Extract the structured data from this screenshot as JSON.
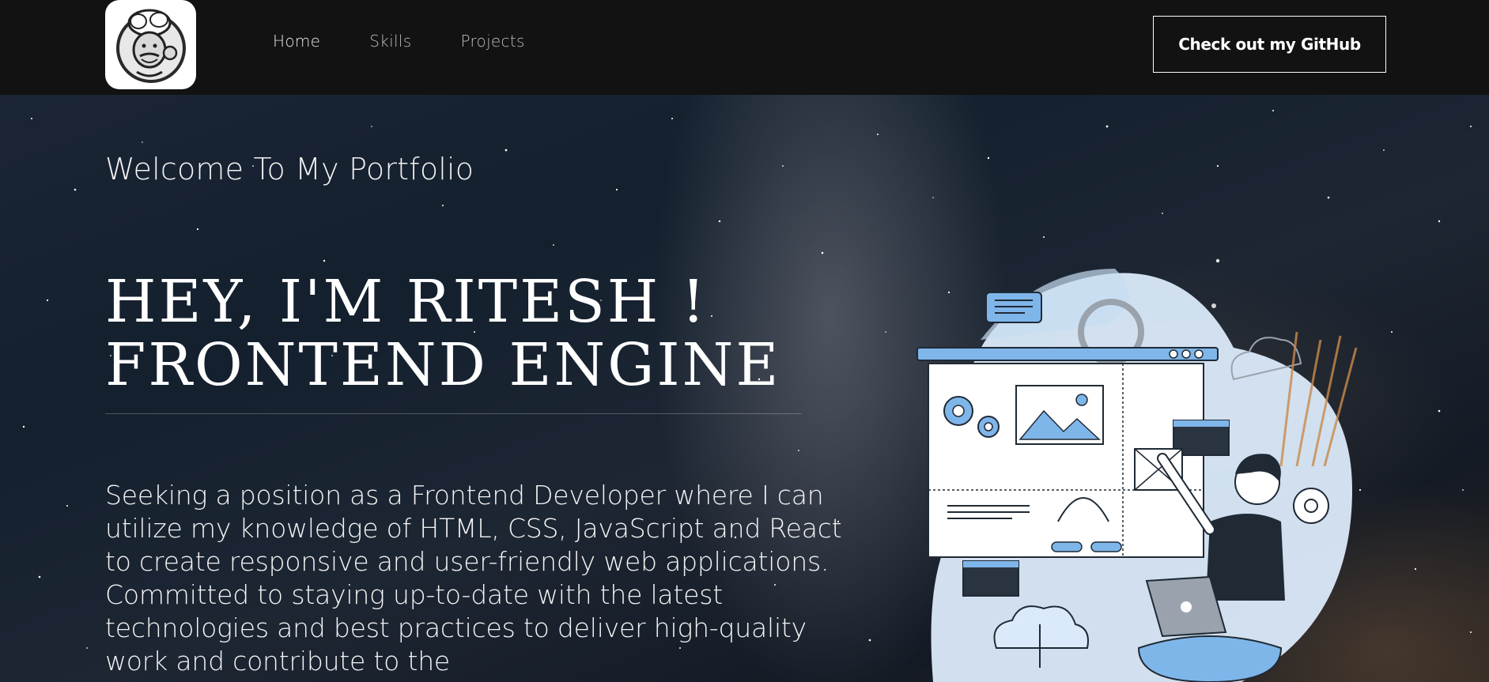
{
  "nav": {
    "logo_alt": "chef-avatar-logo",
    "links": [
      "Home",
      "Skills",
      "Projects"
    ],
    "github_button": "Check out my GitHub"
  },
  "hero": {
    "tagline": "Welcome To My Portfolio",
    "headline_line1": "HEY, I'M RITESH !",
    "headline_line2": "FRONTEND ENGINE",
    "summary": "Seeking a position as a Frontend Developer where I can utilize my knowledge of HTML, CSS, JavaScript and React to create responsive and user-friendly web applications. Committed to staying up-to-date with the latest technologies and best practices to deliver high-quality work and contribute to the"
  },
  "colors": {
    "navbar_bg": "#121212",
    "accent_blue": "#7fb6ea",
    "illustration_blob": "#dbeafa"
  }
}
